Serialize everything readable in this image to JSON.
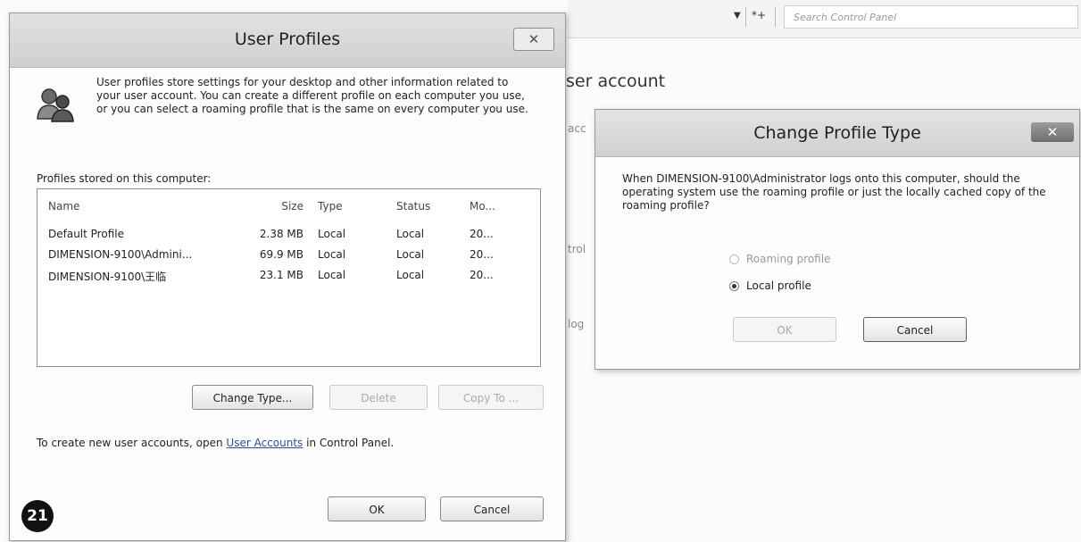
{
  "control_panel": {
    "search_placeholder": "Search Control Panel",
    "heading_fragment": "ser account",
    "fragments": [
      "acc",
      "trol",
      "log"
    ],
    "refresh_glyph": "*+"
  },
  "user_profiles": {
    "title": "User Profiles",
    "close_glyph": "✕",
    "description": "User profiles store settings for your desktop and other information related to your user account. You can create a different profile on each computer you use, or you can select a roaming profile that is the same on every computer you use.",
    "list_label": "Profiles stored on this computer:",
    "columns": {
      "name": "Name",
      "size": "Size",
      "type": "Type",
      "status": "Status",
      "modified": "Mo..."
    },
    "rows": [
      {
        "name": "Default Profile",
        "size": "2.38 MB",
        "type": "Local",
        "status": "Local",
        "modified": "20..."
      },
      {
        "name": "DIMENSION-9100\\Admini...",
        "size": "69.9 MB",
        "type": "Local",
        "status": "Local",
        "modified": "20..."
      },
      {
        "name": "DIMENSION-9100\\王临",
        "size": "23.1 MB",
        "type": "Local",
        "status": "Local",
        "modified": "20..."
      }
    ],
    "change_type_label": "Change Type...",
    "delete_label": "Delete",
    "copy_to_label": "Copy To ...",
    "hint_prefix": "To create new user accounts, open ",
    "hint_link": "User Accounts",
    "hint_suffix": " in Control Panel.",
    "ok_label": "OK",
    "cancel_label": "Cancel"
  },
  "change_profile_type": {
    "title": "Change Profile Type",
    "close_glyph": "✕",
    "message": "When DIMENSION-9100\\Administrator logs onto this computer, should the operating system use the roaming profile or just the locally cached copy of the roaming profile?",
    "roaming_label": "Roaming profile",
    "local_label": "Local profile",
    "selected": "local",
    "ok_label": "OK",
    "cancel_label": "Cancel"
  },
  "figure_number": "21"
}
